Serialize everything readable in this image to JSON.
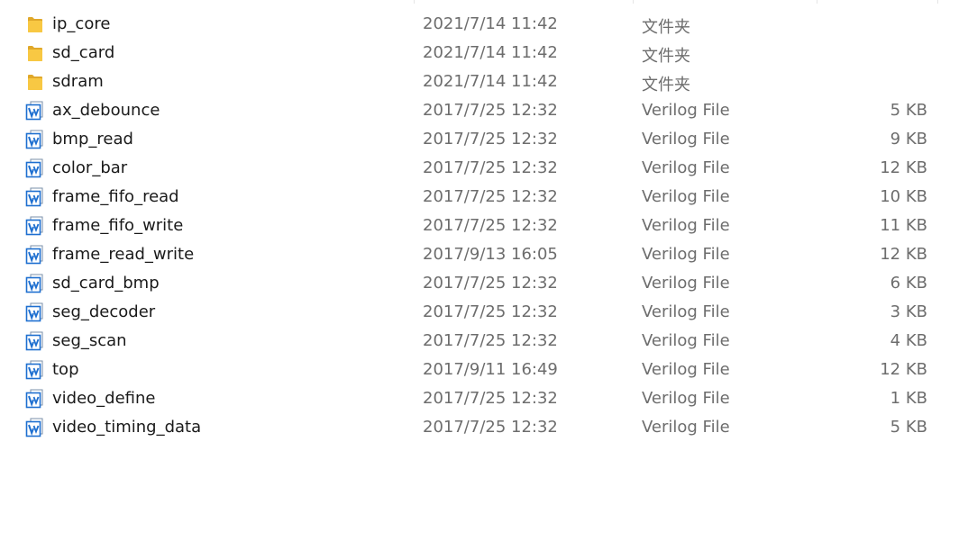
{
  "file_list": {
    "rows": [
      {
        "name": "ip_core",
        "date_modified": "2021/7/14 11:42",
        "type": "文件夹",
        "size": "",
        "icon": "folder-icon"
      },
      {
        "name": "sd_card",
        "date_modified": "2021/7/14 11:42",
        "type": "文件夹",
        "size": "",
        "icon": "folder-icon"
      },
      {
        "name": "sdram",
        "date_modified": "2021/7/14 11:42",
        "type": "文件夹",
        "size": "",
        "icon": "folder-icon"
      },
      {
        "name": "ax_debounce",
        "date_modified": "2017/7/25 12:32",
        "type": "Verilog File",
        "size": "5 KB",
        "icon": "verilog-file-icon"
      },
      {
        "name": "bmp_read",
        "date_modified": "2017/7/25 12:32",
        "type": "Verilog File",
        "size": "9 KB",
        "icon": "verilog-file-icon"
      },
      {
        "name": "color_bar",
        "date_modified": "2017/7/25 12:32",
        "type": "Verilog File",
        "size": "12 KB",
        "icon": "verilog-file-icon"
      },
      {
        "name": "frame_fifo_read",
        "date_modified": "2017/7/25 12:32",
        "type": "Verilog File",
        "size": "10 KB",
        "icon": "verilog-file-icon"
      },
      {
        "name": "frame_fifo_write",
        "date_modified": "2017/7/25 12:32",
        "type": "Verilog File",
        "size": "11 KB",
        "icon": "verilog-file-icon"
      },
      {
        "name": "frame_read_write",
        "date_modified": "2017/9/13 16:05",
        "type": "Verilog File",
        "size": "12 KB",
        "icon": "verilog-file-icon"
      },
      {
        "name": "sd_card_bmp",
        "date_modified": "2017/7/25 12:32",
        "type": "Verilog File",
        "size": "6 KB",
        "icon": "verilog-file-icon"
      },
      {
        "name": "seg_decoder",
        "date_modified": "2017/7/25 12:32",
        "type": "Verilog File",
        "size": "3 KB",
        "icon": "verilog-file-icon"
      },
      {
        "name": "seg_scan",
        "date_modified": "2017/7/25 12:32",
        "type": "Verilog File",
        "size": "4 KB",
        "icon": "verilog-file-icon"
      },
      {
        "name": "top",
        "date_modified": "2017/9/11 16:49",
        "type": "Verilog File",
        "size": "12 KB",
        "icon": "verilog-file-icon"
      },
      {
        "name": "video_define",
        "date_modified": "2017/7/25 12:32",
        "type": "Verilog File",
        "size": "1 KB",
        "icon": "verilog-file-icon"
      },
      {
        "name": "video_timing_data",
        "date_modified": "2017/7/25 12:32",
        "type": "Verilog File",
        "size": "5 KB",
        "icon": "verilog-file-icon"
      }
    ]
  },
  "colors": {
    "name_text": "#1a1a1a",
    "detail_text": "#6d6d6d",
    "folder": "#f8c843",
    "verilog_icon": "#1e6fd0"
  }
}
